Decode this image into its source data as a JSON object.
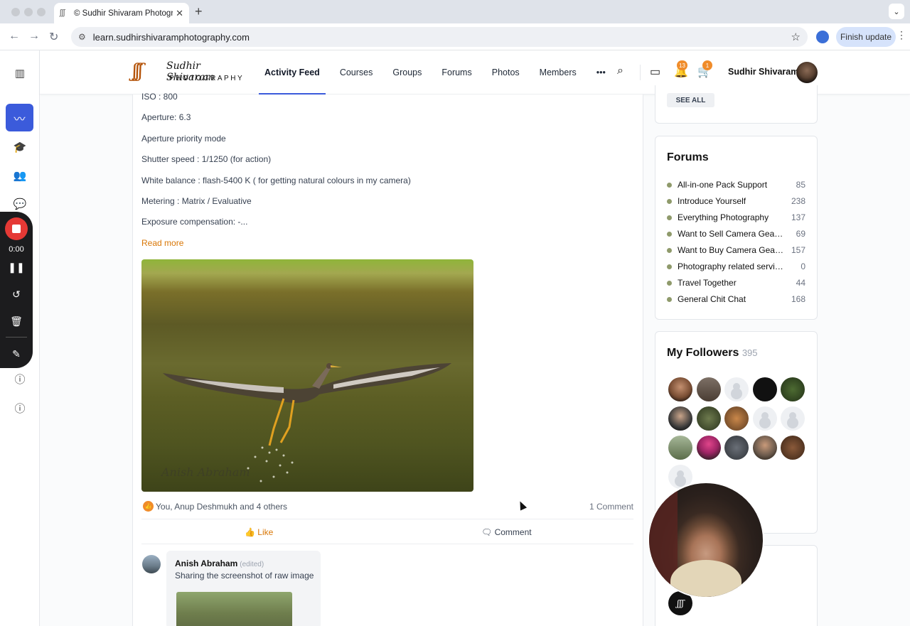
{
  "browser": {
    "tab_title": "© Sudhir Shivaram Photograph",
    "url": "learn.sudhirshivaramphotography.com",
    "finish_update": "Finish update"
  },
  "recorder": {
    "time": "0:00"
  },
  "site": {
    "logo_script": "Sudhir Shivaram",
    "logo_text": "PHOTOGRAPHY",
    "menu": [
      "Activity Feed",
      "Courses",
      "Groups",
      "Forums",
      "Photos",
      "Members"
    ],
    "more": "•••",
    "notifications_count": "13",
    "cart_count": "1",
    "user_name": "Sudhir Shivaram"
  },
  "post": {
    "lines": [
      "ISO : 800",
      "Aperture: 6.3",
      "Aperture priority mode",
      "Shutter speed : 1/1250 (for action)",
      "White balance : flash-5400 K ( for getting natural colours in my camera)",
      "Metering : Matrix / Evaluative",
      "Exposure compensation: -..."
    ],
    "read_more": "Read more",
    "photo_watermark": "Anish Abraham",
    "likes_text": "You, Anup Deshmukh and 4 others",
    "comments_count": "1 Comment",
    "like_label": "Like",
    "comment_label": "Comment",
    "comment": {
      "author": "Anish Abraham",
      "edited": "(edited)",
      "text": "Sharing the screenshot of raw image"
    }
  },
  "sidebar": {
    "see_all": "SEE ALL",
    "forums_title": "Forums",
    "forums": [
      {
        "name": "All-in-one Pack Support",
        "count": "85"
      },
      {
        "name": "Introduce Yourself",
        "count": "238"
      },
      {
        "name": "Everything Photography",
        "count": "137"
      },
      {
        "name": "Want to Sell Camera Gear ...",
        "count": "69"
      },
      {
        "name": "Want to Buy Camera Gear...",
        "count": "157"
      },
      {
        "name": "Photography related services",
        "count": "0"
      },
      {
        "name": "Travel Together",
        "count": "44"
      },
      {
        "name": "General Chit Chat",
        "count": "168"
      }
    ],
    "followers_title": "My Followers",
    "followers_count": "395"
  },
  "colors": {
    "accent": "#3b5bdb",
    "orange": "#d97706",
    "badge": "#f08c2a",
    "record": "#e53935"
  }
}
